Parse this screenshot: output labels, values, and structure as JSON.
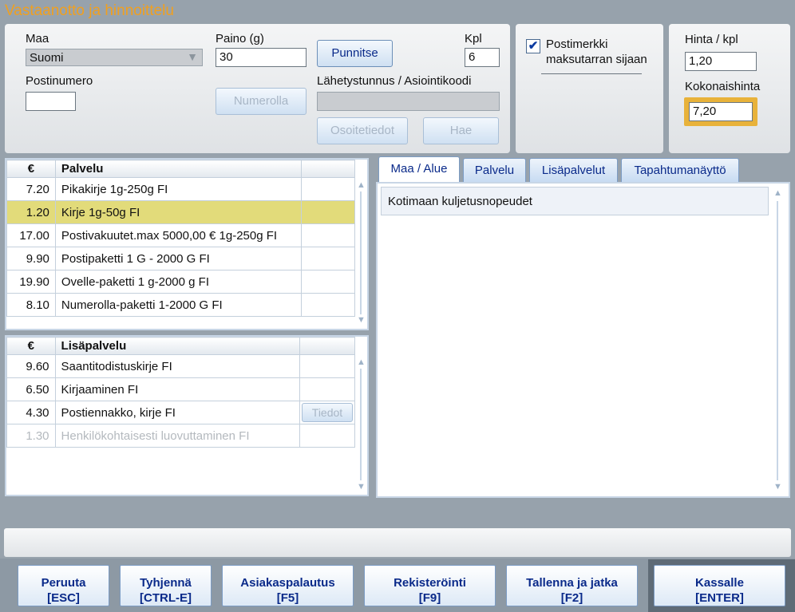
{
  "window": {
    "title": "Vastaanotto ja hinnoittelu"
  },
  "form": {
    "country_label": "Maa",
    "country_value": "Suomi",
    "postal_label": "Postinumero",
    "postal_value": "",
    "weight_label": "Paino (g)",
    "weight_value": "30",
    "weigh_button": "Punnitse",
    "qty_label": "Kpl",
    "qty_value": "6",
    "number_button": "Numerolla",
    "tracking_label": "Lähetystunnus / Asiointikoodi",
    "tracking_value": "",
    "address_button": "Osoitetiedot",
    "search_button": "Hae"
  },
  "stamp": {
    "label_line1": "Postimerkki",
    "label_line2": "maksutarran sijaan",
    "checked": true
  },
  "price": {
    "unit_label": "Hinta / kpl",
    "unit_value": "1,20",
    "total_label": "Kokonaishinta",
    "total_value": "7,20",
    "highlight_color": "#e8b23a"
  },
  "services": {
    "headers": {
      "currency": "€",
      "name": "Palvelu"
    },
    "rows": [
      {
        "price": "7.20",
        "name": "Pikakirje 1g-250g FI"
      },
      {
        "price": "1.20",
        "name": "Kirje 1g-50g FI",
        "selected": true
      },
      {
        "price": "17.00",
        "name": "Postivakuutet.max 5000,00 € 1g-250g FI"
      },
      {
        "price": "9.90",
        "name": "Postipaketti  1 G - 2000 G FI"
      },
      {
        "price": "19.90",
        "name": "Ovelle-paketti 1 g-2000 g FI"
      },
      {
        "price": "8.10",
        "name": "Numerolla-paketti 1-2000 G FI"
      }
    ]
  },
  "addons": {
    "headers": {
      "currency": "€",
      "name": "Lisäpalvelu"
    },
    "details_button": "Tiedot",
    "rows": [
      {
        "price": "9.60",
        "name": "Saantitodistuskirje FI"
      },
      {
        "price": "6.50",
        "name": "Kirjaaminen FI"
      },
      {
        "price": "4.30",
        "name": "Postiennakko, kirje FI"
      },
      {
        "price": "1.30",
        "name": "Henkilökohtaisesti luovuttaminen FI",
        "disabled": true
      }
    ]
  },
  "tabs": [
    {
      "label": "Maa / Alue",
      "active": true
    },
    {
      "label": "Palvelu"
    },
    {
      "label": "Lisäpalvelut"
    },
    {
      "label": "Tapahtumanäyttö"
    }
  ],
  "tab_content": {
    "row1": "Kotimaan kuljetusnopeudet"
  },
  "status_bar": {
    "text": ""
  },
  "footer": [
    {
      "label": "Peruuta",
      "key": "[ESC]"
    },
    {
      "label": "Tyhjennä",
      "key": "[CTRL-E]"
    },
    {
      "label": "Asiakaspalautus",
      "key": "[F5]"
    },
    {
      "label": "Rekisteröinti",
      "key": "[F9]"
    },
    {
      "label": "Tallenna ja jatka",
      "key": "[F2]"
    },
    {
      "label": "Kassalle",
      "key": "[ENTER]"
    }
  ],
  "icons": {
    "dropdown": "chevron-down-icon",
    "check": "checkmark-icon",
    "scroll_up": "arrow-up-icon",
    "scroll_down": "arrow-down-icon"
  }
}
